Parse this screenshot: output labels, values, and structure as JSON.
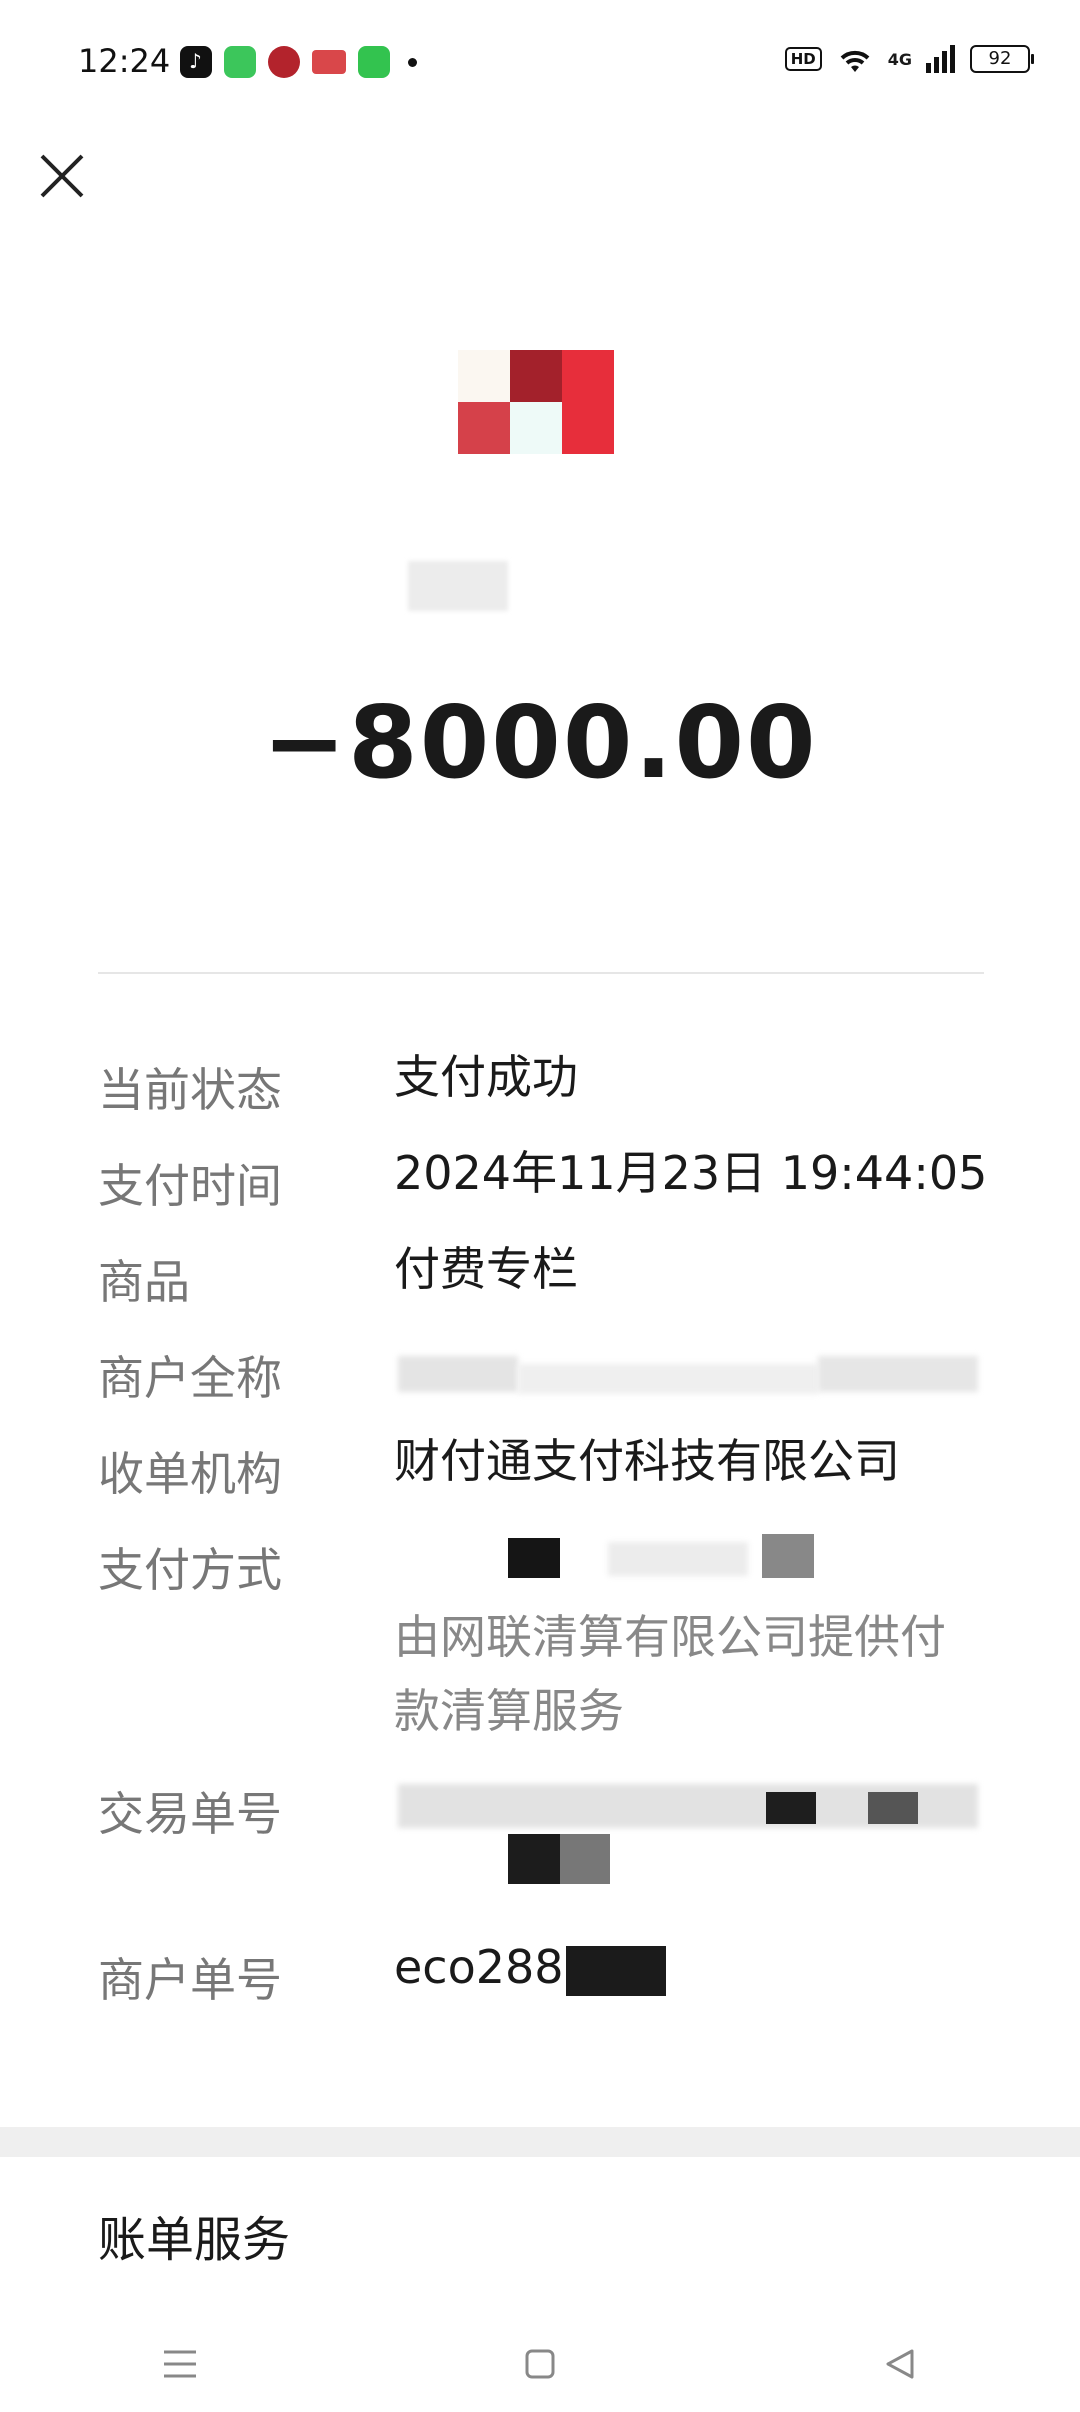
{
  "status_bar": {
    "time": "12:24",
    "hd": "HD",
    "network": "4G",
    "battery": "92",
    "app_icons": [
      "tiktok-icon",
      "green-app-icon",
      "bank-icon",
      "news-icon",
      "message-icon"
    ]
  },
  "header": {
    "close_icon": "close-icon"
  },
  "transaction": {
    "amount": "−8000.00"
  },
  "details": {
    "status_label": "当前状态",
    "status_value": "支付成功",
    "time_label": "支付时间",
    "time_value": "2024年11月23日 19:44:05",
    "goods_label": "商品",
    "goods_value": "付费专栏",
    "merchant_label": "商户全称",
    "acquirer_label": "收单机构",
    "acquirer_value": "财付通支付科技有限公司",
    "pay_method_label": "支付方式",
    "pay_method_note": "由网联清算有限公司提供付款清算服务",
    "txn_no_label": "交易单号",
    "merchant_no_label": "商户单号",
    "merchant_no_value": "eco288"
  },
  "footer": {
    "bill_service": "账单服务"
  },
  "colors": {
    "accent_red": "#e0283a",
    "text_dark": "#1a1a1a",
    "text_grey": "#777777"
  }
}
